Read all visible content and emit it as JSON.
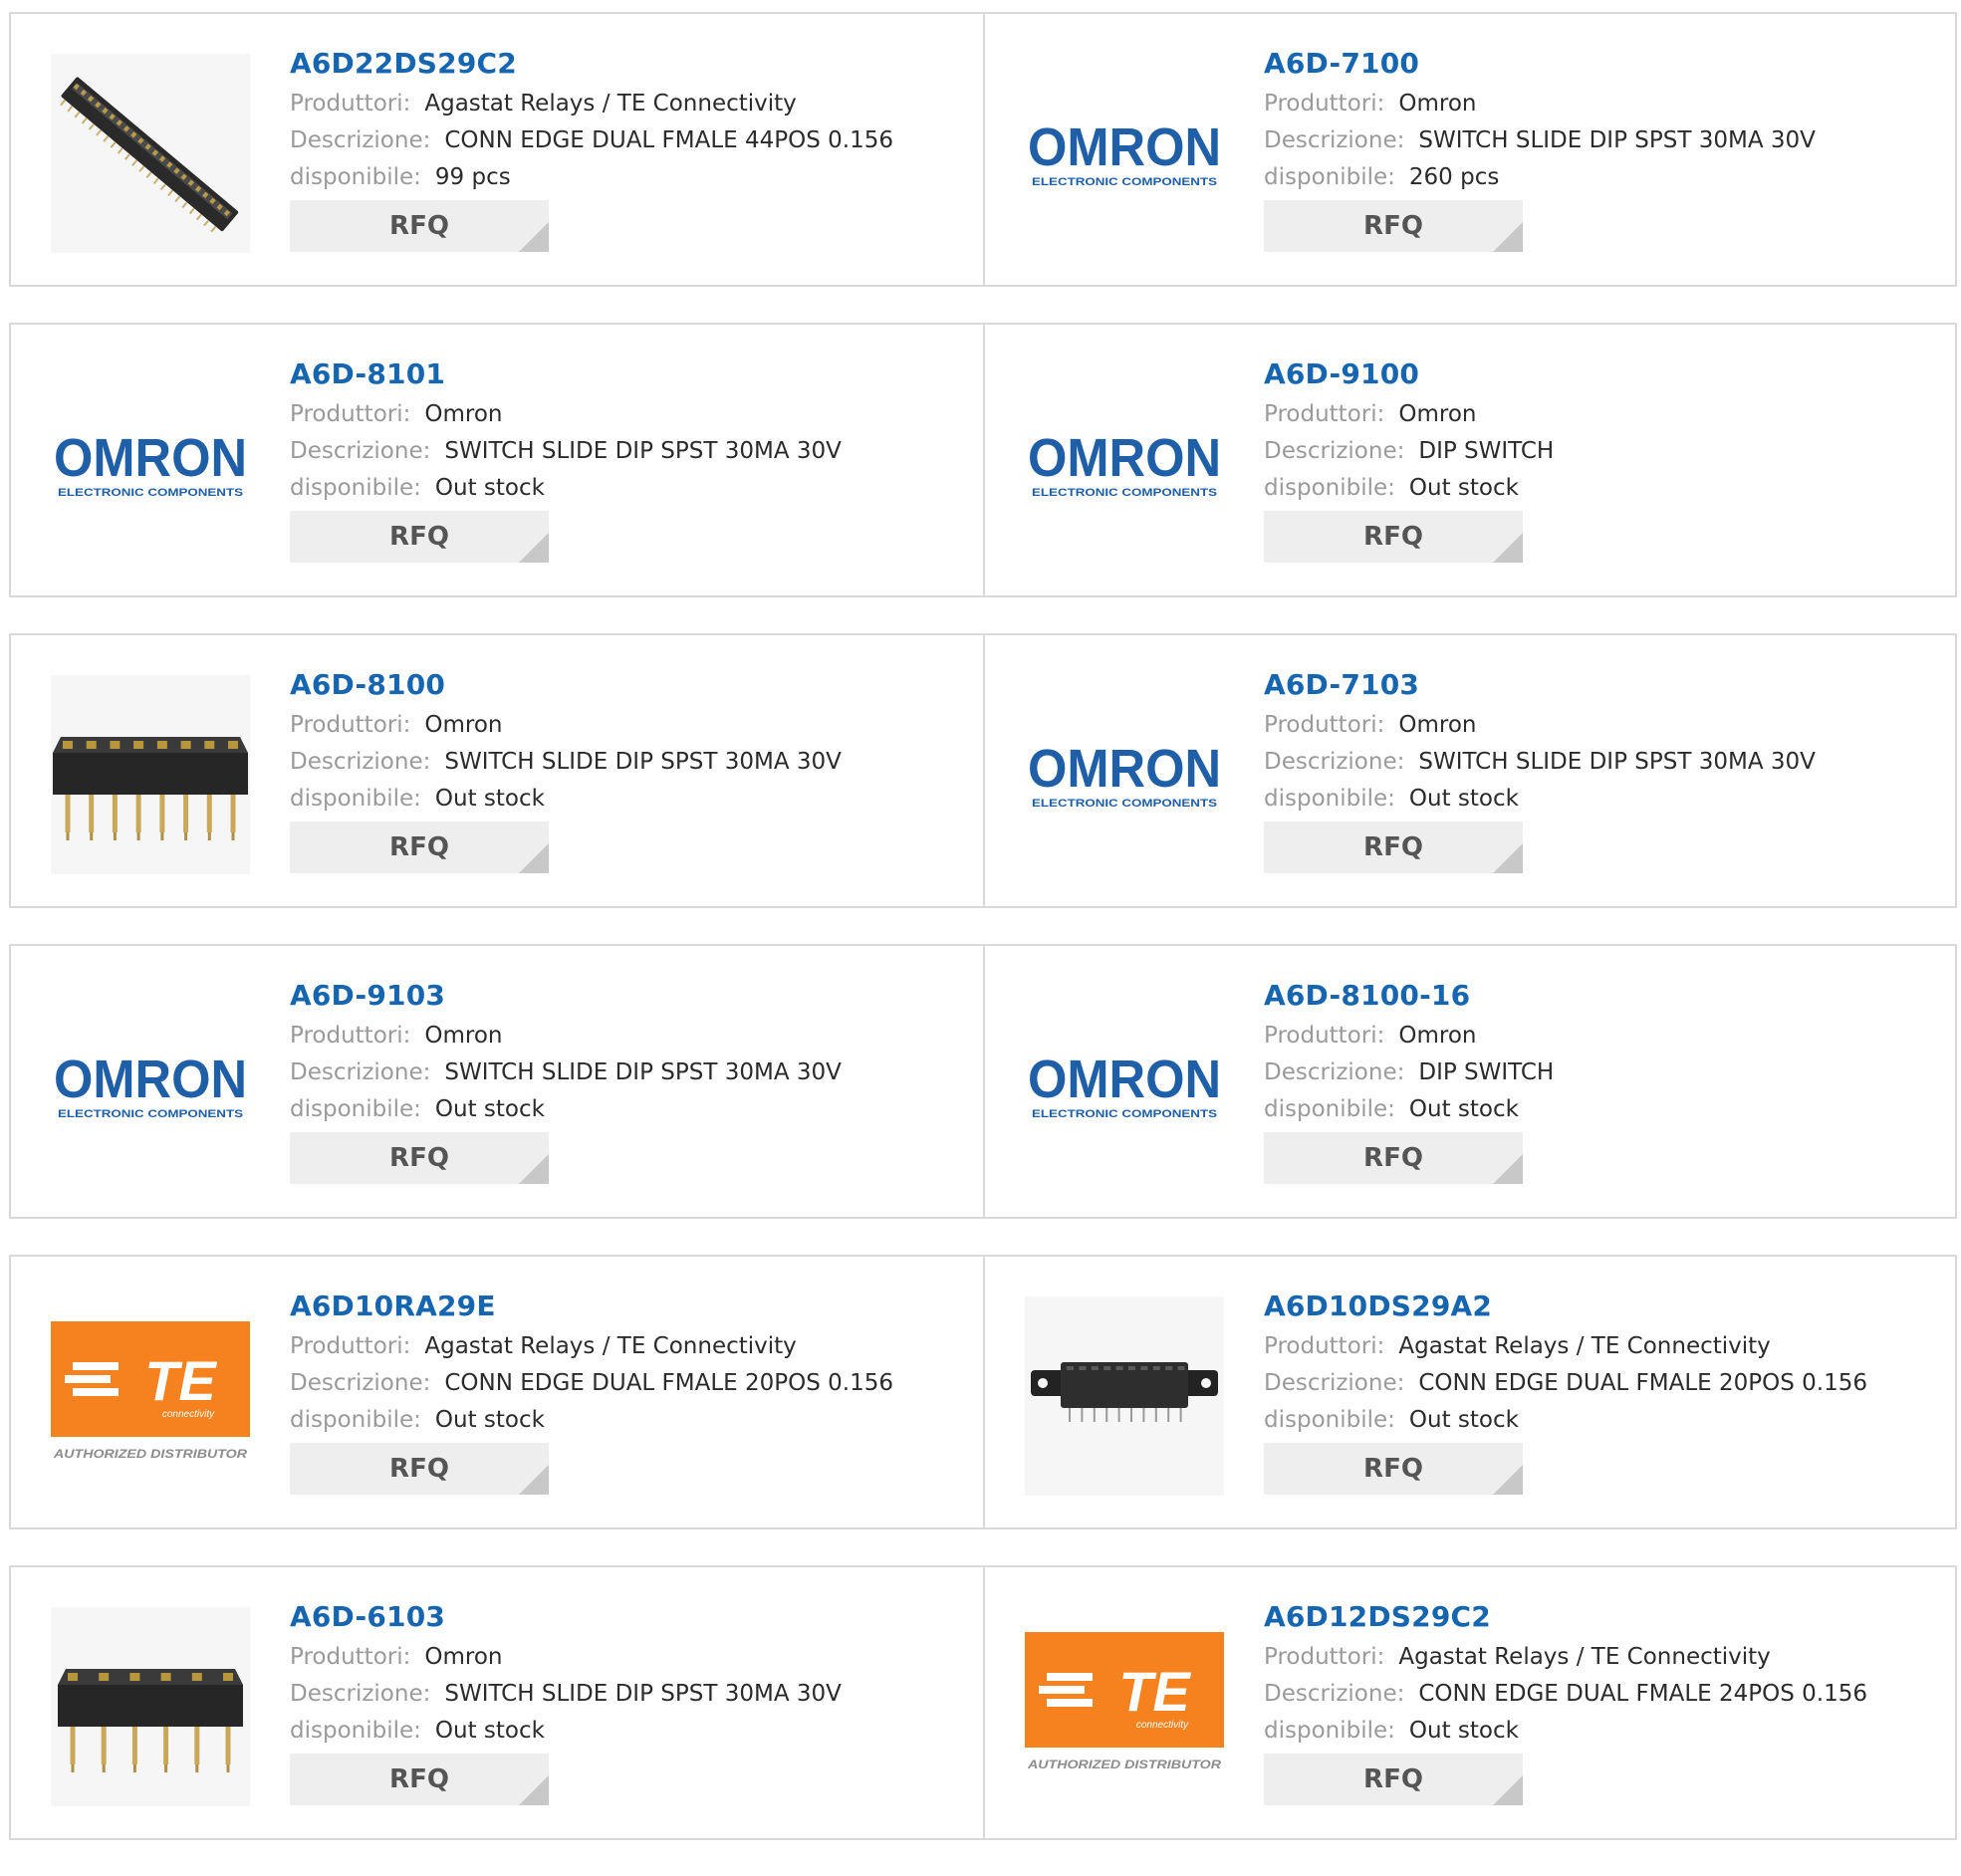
{
  "labels": {
    "manufacturer": "Produttori:",
    "description": "Descrizione:",
    "availability": "disponibile:",
    "rfq": "RFQ"
  },
  "logo_text": {
    "omron": "OMRON",
    "omron_sub": "ELECTRONIC COMPONENTS",
    "te": "TE",
    "te_sub": "connectivity",
    "te_tag": "AUTHORIZED DISTRIBUTOR"
  },
  "colors": {
    "part_link": "#1565b0",
    "omron_blue": "#1f5fa8",
    "te_orange": "#f5821f"
  },
  "products": [
    {
      "part": "A6D22DS29C2",
      "manufacturer": "Agastat Relays / TE Connectivity",
      "description": "CONN EDGE DUAL FMALE 44POS 0.156",
      "availability": "99 pcs",
      "image": "edge-connector-long"
    },
    {
      "part": "A6D-7100",
      "manufacturer": "Omron",
      "description": "SWITCH SLIDE DIP SPST 30MA 30V",
      "availability": "260 pcs",
      "image": "omron-logo"
    },
    {
      "part": "A6D-8101",
      "manufacturer": "Omron",
      "description": "SWITCH SLIDE DIP SPST 30MA 30V",
      "availability": "Out stock",
      "image": "omron-logo"
    },
    {
      "part": "A6D-9100",
      "manufacturer": "Omron",
      "description": "DIP SWITCH",
      "availability": "Out stock",
      "image": "omron-logo"
    },
    {
      "part": "A6D-8100",
      "manufacturer": "Omron",
      "description": "SWITCH SLIDE DIP SPST 30MA 30V",
      "availability": "Out stock",
      "image": "dip-switch-8"
    },
    {
      "part": "A6D-7103",
      "manufacturer": "Omron",
      "description": "SWITCH SLIDE DIP SPST 30MA 30V",
      "availability": "Out stock",
      "image": "omron-logo"
    },
    {
      "part": "A6D-9103",
      "manufacturer": "Omron",
      "description": "SWITCH SLIDE DIP SPST 30MA 30V",
      "availability": "Out stock",
      "image": "omron-logo"
    },
    {
      "part": "A6D-8100-16",
      "manufacturer": "Omron",
      "description": "DIP SWITCH",
      "availability": "Out stock",
      "image": "omron-logo"
    },
    {
      "part": "A6D10RA29E",
      "manufacturer": "Agastat Relays / TE Connectivity",
      "description": "CONN EDGE DUAL FMALE 20POS 0.156",
      "availability": "Out stock",
      "image": "te-logo"
    },
    {
      "part": "A6D10DS29A2",
      "manufacturer": "Agastat Relays / TE Connectivity",
      "description": "CONN EDGE DUAL FMALE 20POS 0.156",
      "availability": "Out stock",
      "image": "edge-connector-short"
    },
    {
      "part": "A6D-6103",
      "manufacturer": "Omron",
      "description": "SWITCH SLIDE DIP SPST 30MA 30V",
      "availability": "Out stock",
      "image": "dip-switch-6"
    },
    {
      "part": "A6D12DS29C2",
      "manufacturer": "Agastat Relays / TE Connectivity",
      "description": "CONN EDGE DUAL FMALE 24POS 0.156",
      "availability": "Out stock",
      "image": "te-logo"
    }
  ]
}
